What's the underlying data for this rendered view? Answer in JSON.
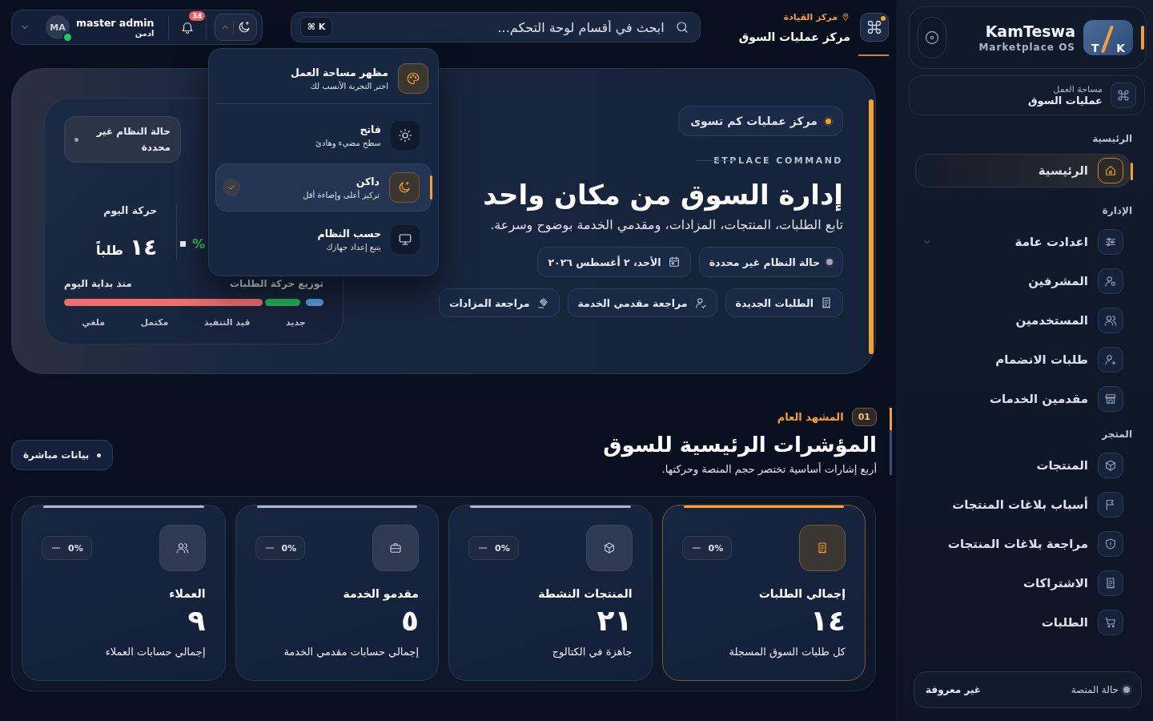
{
  "topbar": {
    "location": "مركز القيادة",
    "title": "مركز عمليات السوق",
    "search": {
      "placeholder": "ابحث في أقسام لوحة التحكم...",
      "shortcut": "⌘ K"
    },
    "notifications": {
      "count": "34"
    },
    "theme_toggle": {
      "expanded": true
    },
    "user": {
      "name": "master admin",
      "role": "ادمن",
      "initials": "MA",
      "online": true
    }
  },
  "theme_menu": {
    "title": "مظهر مساحة العمل",
    "subtitle": "اختر التجربة الأنسب لك",
    "options": [
      {
        "label": "فاتح",
        "description": "سطح مضيء وهادئ",
        "selected": false
      },
      {
        "label": "داكن",
        "description": "تركيز أعلى وإضاءة أقل",
        "selected": true
      },
      {
        "label": "حسب النظام",
        "description": "يتبع إعداد جهازك",
        "selected": false
      }
    ]
  },
  "hero": {
    "badge": "مركز عمليات كم تسوى",
    "eyebrow": "ETPLACE COMMAND",
    "title": "إدارة السوق من مكان واحد",
    "subtitle": "تابع الطلبات، المنتجات، المزادات، ومقدمي الخدمة بوضوح وسرعة.",
    "chips": [
      "حالة النظام غير محددة",
      "الأحد، ٢ أغسطس ٢٠٢٦"
    ],
    "actions": [
      "الطلبات الجديدة",
      "مراجعة مقدمي الخدمة",
      "مراجعة المزادات"
    ],
    "panel": {
      "status": "حالة النظام غير محددة",
      "today_label": "حركة اليوم",
      "today_value": "١٤",
      "today_unit": "طلباً",
      "change": "%",
      "distribution_title": "توزيع حركة الطلبات",
      "distribution_note": "منذ بداية اليوم",
      "legend": [
        "جديد",
        "قيد التنفيذ",
        "مكتمل",
        "ملغي"
      ]
    }
  },
  "overview": {
    "index": "01",
    "eyebrow": "المشهد العام",
    "title": "المؤشرات الرئيسية للسوق",
    "subtitle": "أربع إشارات أساسية تختصر حجم المنصة وحركتها.",
    "live": "بيانات مباشرة"
  },
  "cards": [
    {
      "label": "إجمالي الطلبات",
      "value": "١٤",
      "description": "كل طلبات السوق المسجلة",
      "change": "0%",
      "highlighted": true
    },
    {
      "label": "المنتجات النشطة",
      "value": "٢١",
      "description": "جاهزة في الكتالوج",
      "change": "0%",
      "highlighted": false
    },
    {
      "label": "مقدمو الخدمة",
      "value": "٥",
      "description": "إجمالي حسابات مقدمي الخدمة",
      "change": "0%",
      "highlighted": false
    },
    {
      "label": "العملاء",
      "value": "٩",
      "description": "إجمالي حسابات العملاء",
      "change": "0%",
      "highlighted": false
    }
  ],
  "sidebar": {
    "brand": {
      "logo_left": "T",
      "logo_right": "K",
      "name": "KamTeswa",
      "tagline": "Marketplace OS"
    },
    "workspace": {
      "label": "مساحة العمل",
      "value": "عمليات السوق"
    },
    "sections": [
      {
        "title": "الرئيسية",
        "items": [
          {
            "label": "الرئيسية",
            "selected": true
          }
        ]
      },
      {
        "title": "الإدارة",
        "items": [
          {
            "label": "اعدادت عامة",
            "selected": false,
            "expandable": true
          },
          {
            "label": "المشرفين",
            "selected": false
          },
          {
            "label": "المستخدمين",
            "selected": false
          },
          {
            "label": "طلبات الانضمام",
            "selected": false
          },
          {
            "label": "مقدمين الخدمات",
            "selected": false
          }
        ]
      },
      {
        "title": "المتجر",
        "items": [
          {
            "label": "المنتجات",
            "selected": false
          },
          {
            "label": "أسباب بلاغات المنتجات",
            "selected": false
          },
          {
            "label": "مراجعة بلاغات المنتجات",
            "selected": false
          },
          {
            "label": "الاشتراكات",
            "selected": false
          },
          {
            "label": "الطلبات",
            "selected": false
          }
        ]
      }
    ],
    "footer": {
      "label": "حالة المنصة",
      "value": "غير معروفة"
    }
  }
}
